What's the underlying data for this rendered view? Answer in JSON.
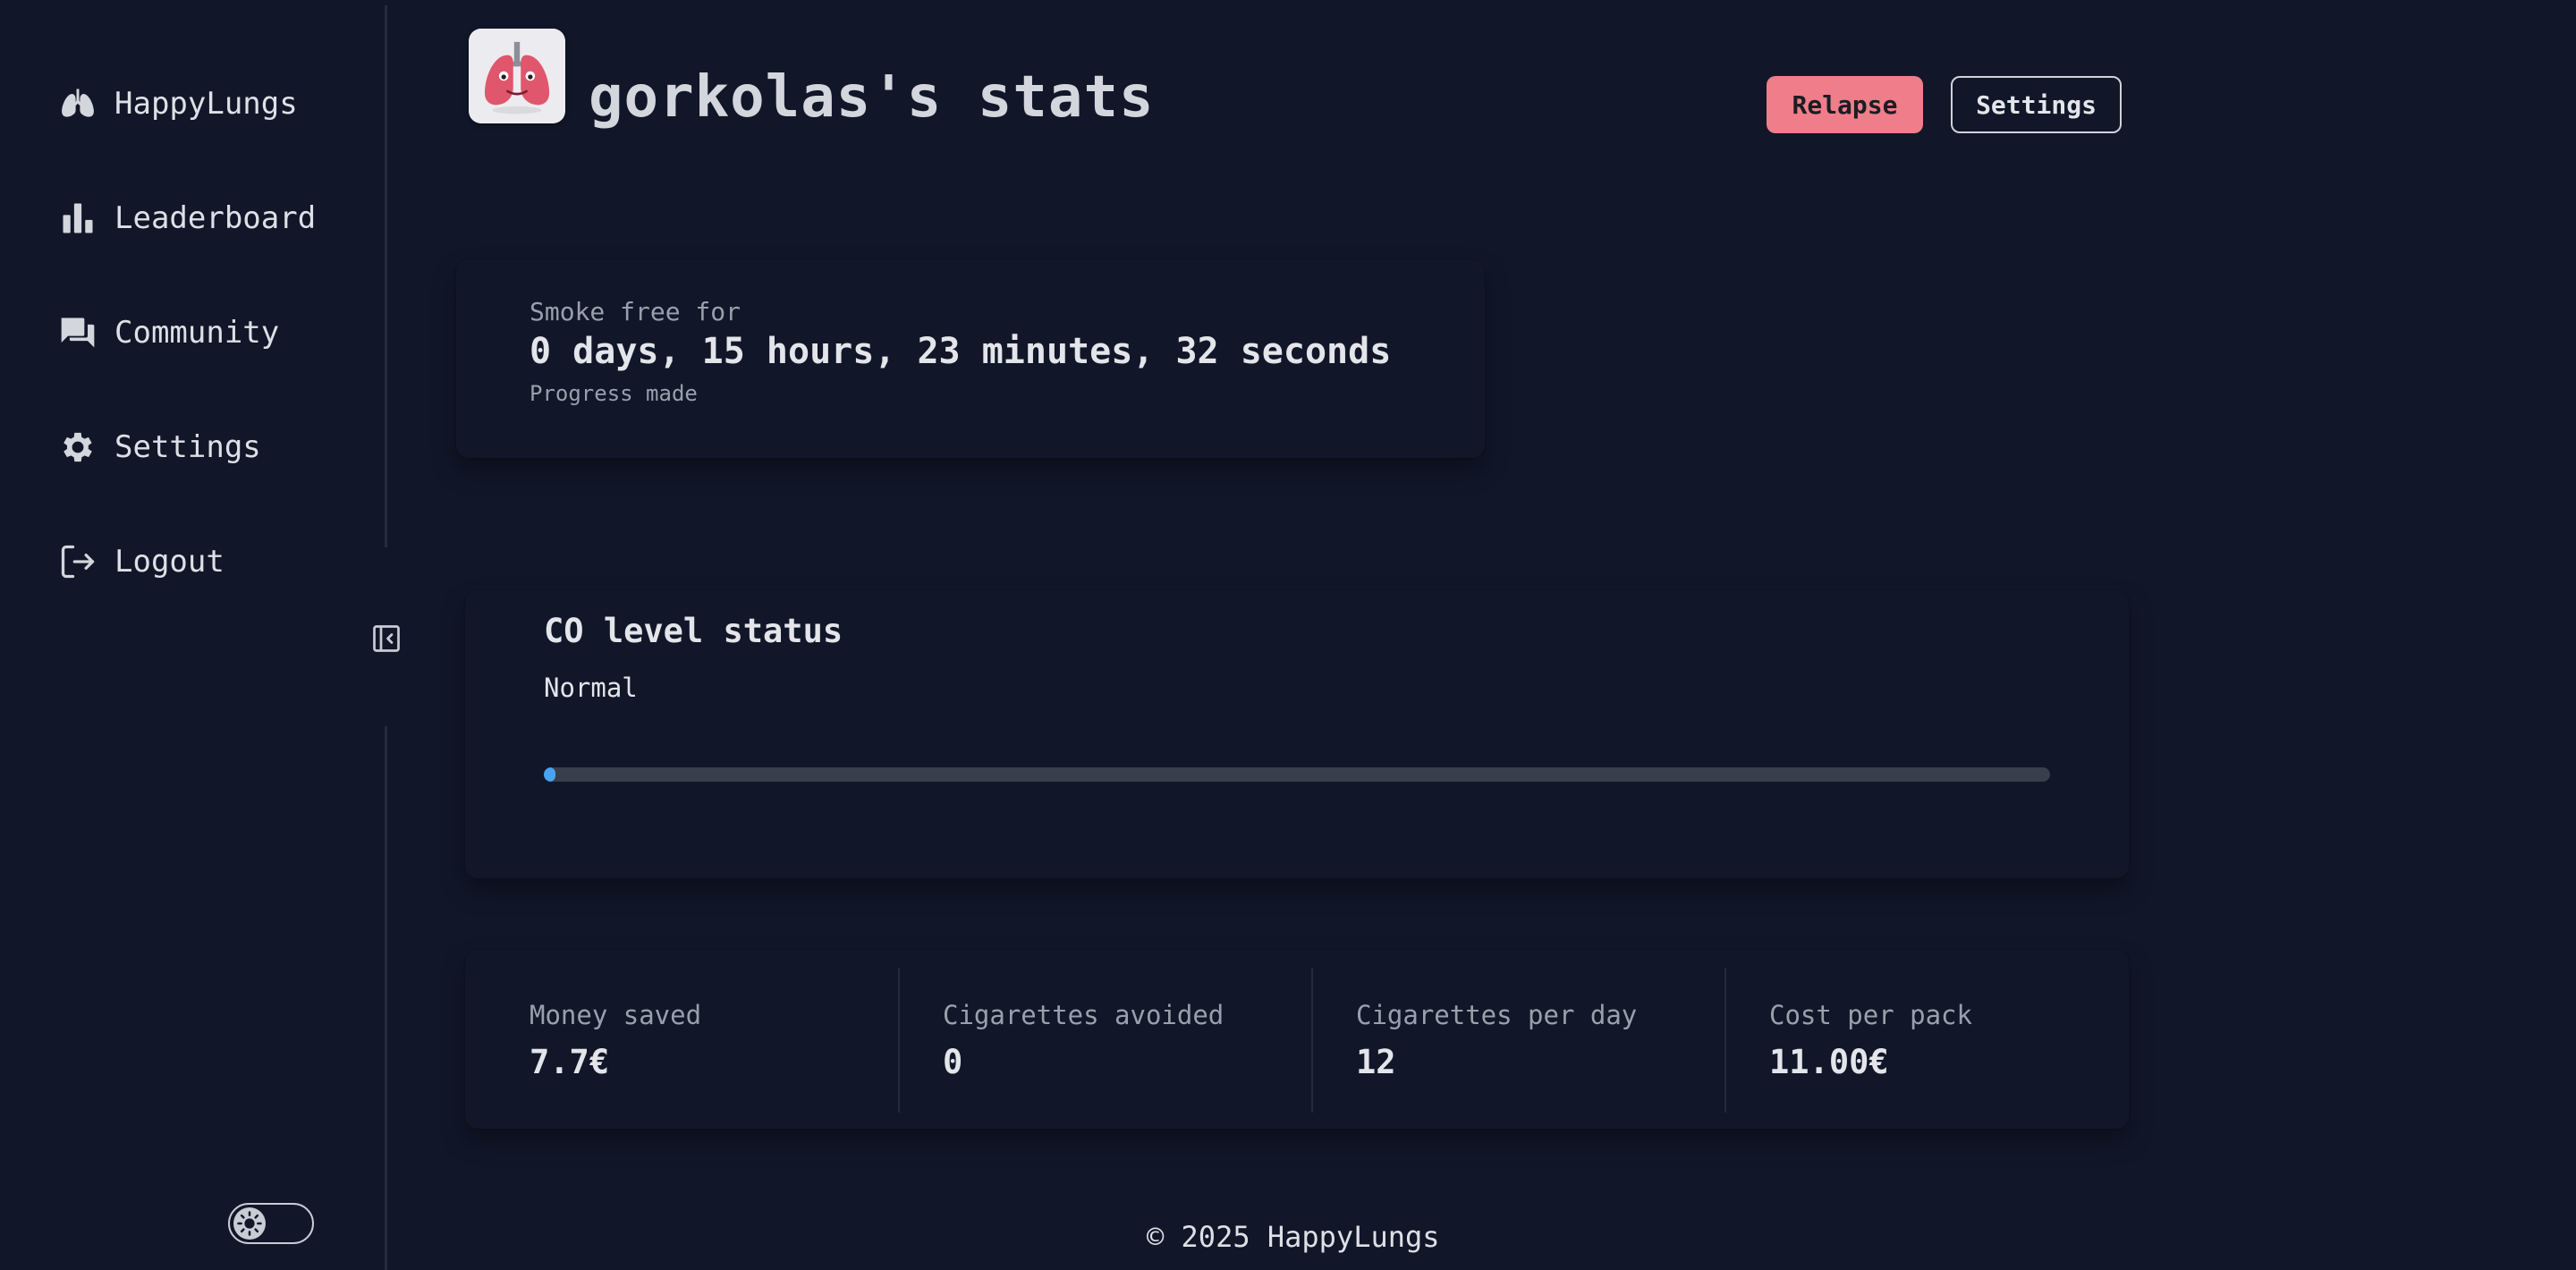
{
  "sidebar": {
    "items": [
      {
        "label": "HappyLungs",
        "icon": "lungs-icon"
      },
      {
        "label": "Leaderboard",
        "icon": "bar-chart-icon"
      },
      {
        "label": "Community",
        "icon": "chat-bubbles-icon"
      },
      {
        "label": "Settings",
        "icon": "gear-icon"
      },
      {
        "label": "Logout",
        "icon": "logout-icon"
      }
    ],
    "collapse_icon": "collapse-sidebar-icon",
    "theme_toggle_icon": "sun-icon"
  },
  "header": {
    "title": "gorkolas's stats",
    "avatar_icon": "lungs-avatar",
    "relapse_label": "Relapse",
    "settings_label": "Settings"
  },
  "smoke_free": {
    "label": "Smoke free for",
    "value": "0 days, 15 hours, 23 minutes, 32 seconds",
    "sub": "Progress made"
  },
  "co_level": {
    "title": "CO level status",
    "status": "Normal",
    "progress_fraction": 0.008
  },
  "stats": [
    {
      "label": "Money saved",
      "value": "7.7€"
    },
    {
      "label": "Cigarettes avoided",
      "value": "0"
    },
    {
      "label": "Cigarettes per day",
      "value": "12"
    },
    {
      "label": "Cost per pack",
      "value": "11.00€"
    }
  ],
  "footer": {
    "text": "© 2025 HappyLungs"
  },
  "colors": {
    "background": "#111729",
    "relapse_button": "#f07d8a",
    "progress_fill": "#4aa3f0",
    "progress_track": "#383e4c"
  }
}
